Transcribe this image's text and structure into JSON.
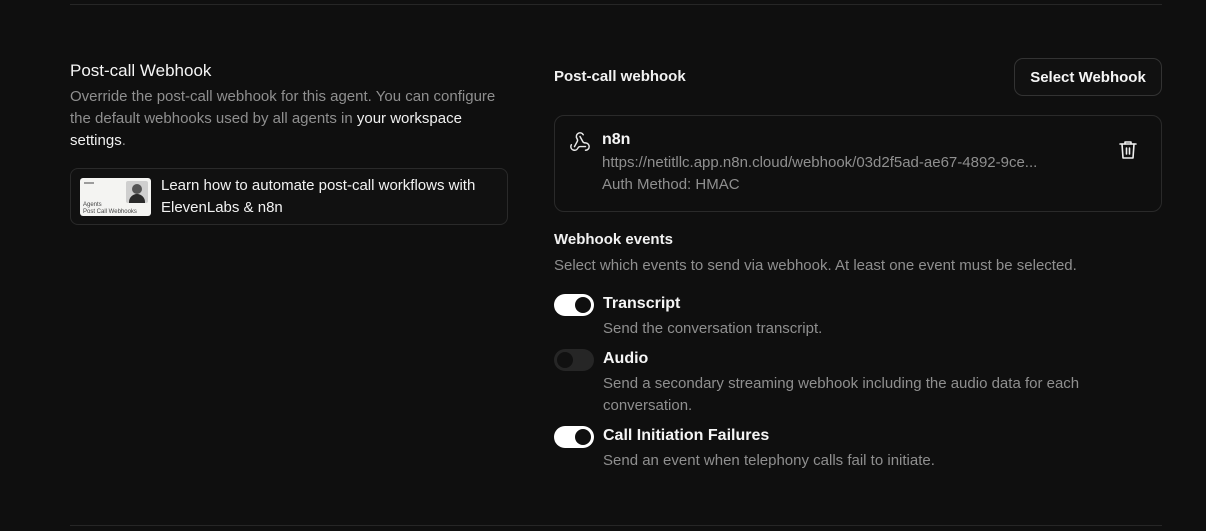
{
  "left": {
    "title": "Post-call Webhook",
    "desc_prefix": "Override the post-call webhook for this agent. You can configure the default webhooks used by all agents in ",
    "desc_link": "your workspace settings",
    "desc_suffix": ".",
    "learn_card": {
      "text": "Learn how to automate post-call workflows with ElevenLabs & n8n",
      "thumb_line1": "Agents",
      "thumb_line2": "Post Call Webhooks"
    }
  },
  "right": {
    "label": "Post-call webhook",
    "select_button": "Select Webhook",
    "webhook": {
      "name": "n8n",
      "url": "https://netitllc.app.n8n.cloud/webhook/03d2f5ad-ae67-4892-9ce...",
      "auth": "Auth Method: HMAC",
      "icon": "webhook-icon"
    },
    "events_title": "Webhook events",
    "events_desc": "Select which events to send via webhook. At least one event must be selected.",
    "events": [
      {
        "name": "Transcript",
        "desc": "Send the conversation transcript.",
        "enabled": true
      },
      {
        "name": "Audio",
        "desc": "Send a secondary streaming webhook including the audio data for each conversation.",
        "enabled": false
      },
      {
        "name": "Call Initiation Failures",
        "desc": "Send an event when telephony calls fail to initiate.",
        "enabled": true
      }
    ]
  },
  "colors": {
    "background": "#0f0f0f",
    "muted_text": "#8f8f8f",
    "toggle_on": "#ffffff",
    "toggle_off": "#262626"
  }
}
